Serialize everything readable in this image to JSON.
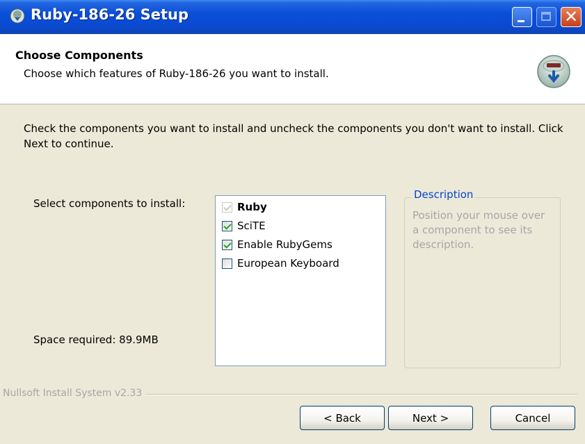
{
  "window": {
    "title": "Ruby-186-26 Setup",
    "icon": "installer-icon"
  },
  "header": {
    "title": "Choose Components",
    "subtitle": "Choose which features of Ruby-186-26 you want to install.",
    "icon": "nsis-install-icon"
  },
  "body": {
    "intro": "Check the components you want to install and uncheck the components you don't want to install. Click Next to continue.",
    "select_label": "Select components to install:",
    "space_required": "Space required: 89.9MB",
    "components": [
      {
        "label": "Ruby",
        "checked": true,
        "disabled": true,
        "bold": true
      },
      {
        "label": "SciTE",
        "checked": true,
        "disabled": false,
        "bold": false
      },
      {
        "label": "Enable RubyGems",
        "checked": true,
        "disabled": false,
        "bold": false
      },
      {
        "label": "European Keyboard",
        "checked": false,
        "disabled": false,
        "bold": false
      }
    ],
    "description": {
      "legend": "Description",
      "text": "Position your mouse over a component to see its description."
    }
  },
  "footer": {
    "branding": "Nullsoft Install System v2.33",
    "back_label": "< Back",
    "next_label": "Next >",
    "cancel_label": "Cancel"
  },
  "colors": {
    "title_bar": "#0a4ed8",
    "dialog_bg": "#ECE9D8",
    "legend_text": "#0046d5",
    "disabled_text": "#a7a6aa"
  }
}
